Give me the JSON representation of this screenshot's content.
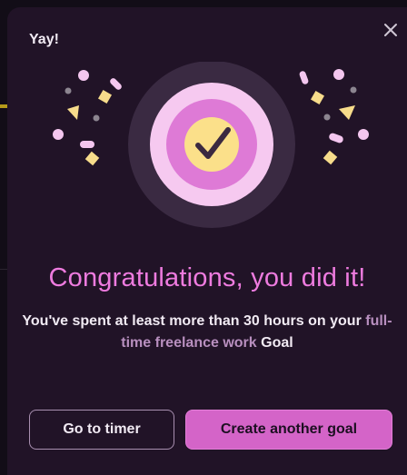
{
  "modal": {
    "title": "Yay!",
    "close_icon": "close-icon",
    "illustration_icon": "checkmark-badge-icon"
  },
  "content": {
    "headline": "Congratulations, you did it!",
    "message_prefix": "You've spent at least more than 30 hours on your",
    "goal_name": "full-time freelance work",
    "message_suffix": "Goal"
  },
  "actions": {
    "secondary_label": "Go to timer",
    "primary_label": "Create another goal"
  },
  "colors": {
    "accent": "#d464c8",
    "headline": "#ee7bdf",
    "confetti_pink": "#f4c6ef",
    "confetti_yellow": "#f7dc8b",
    "badge_yellow": "#fbe08a",
    "badge_outer": "#3a2a42",
    "background": "#211327"
  }
}
